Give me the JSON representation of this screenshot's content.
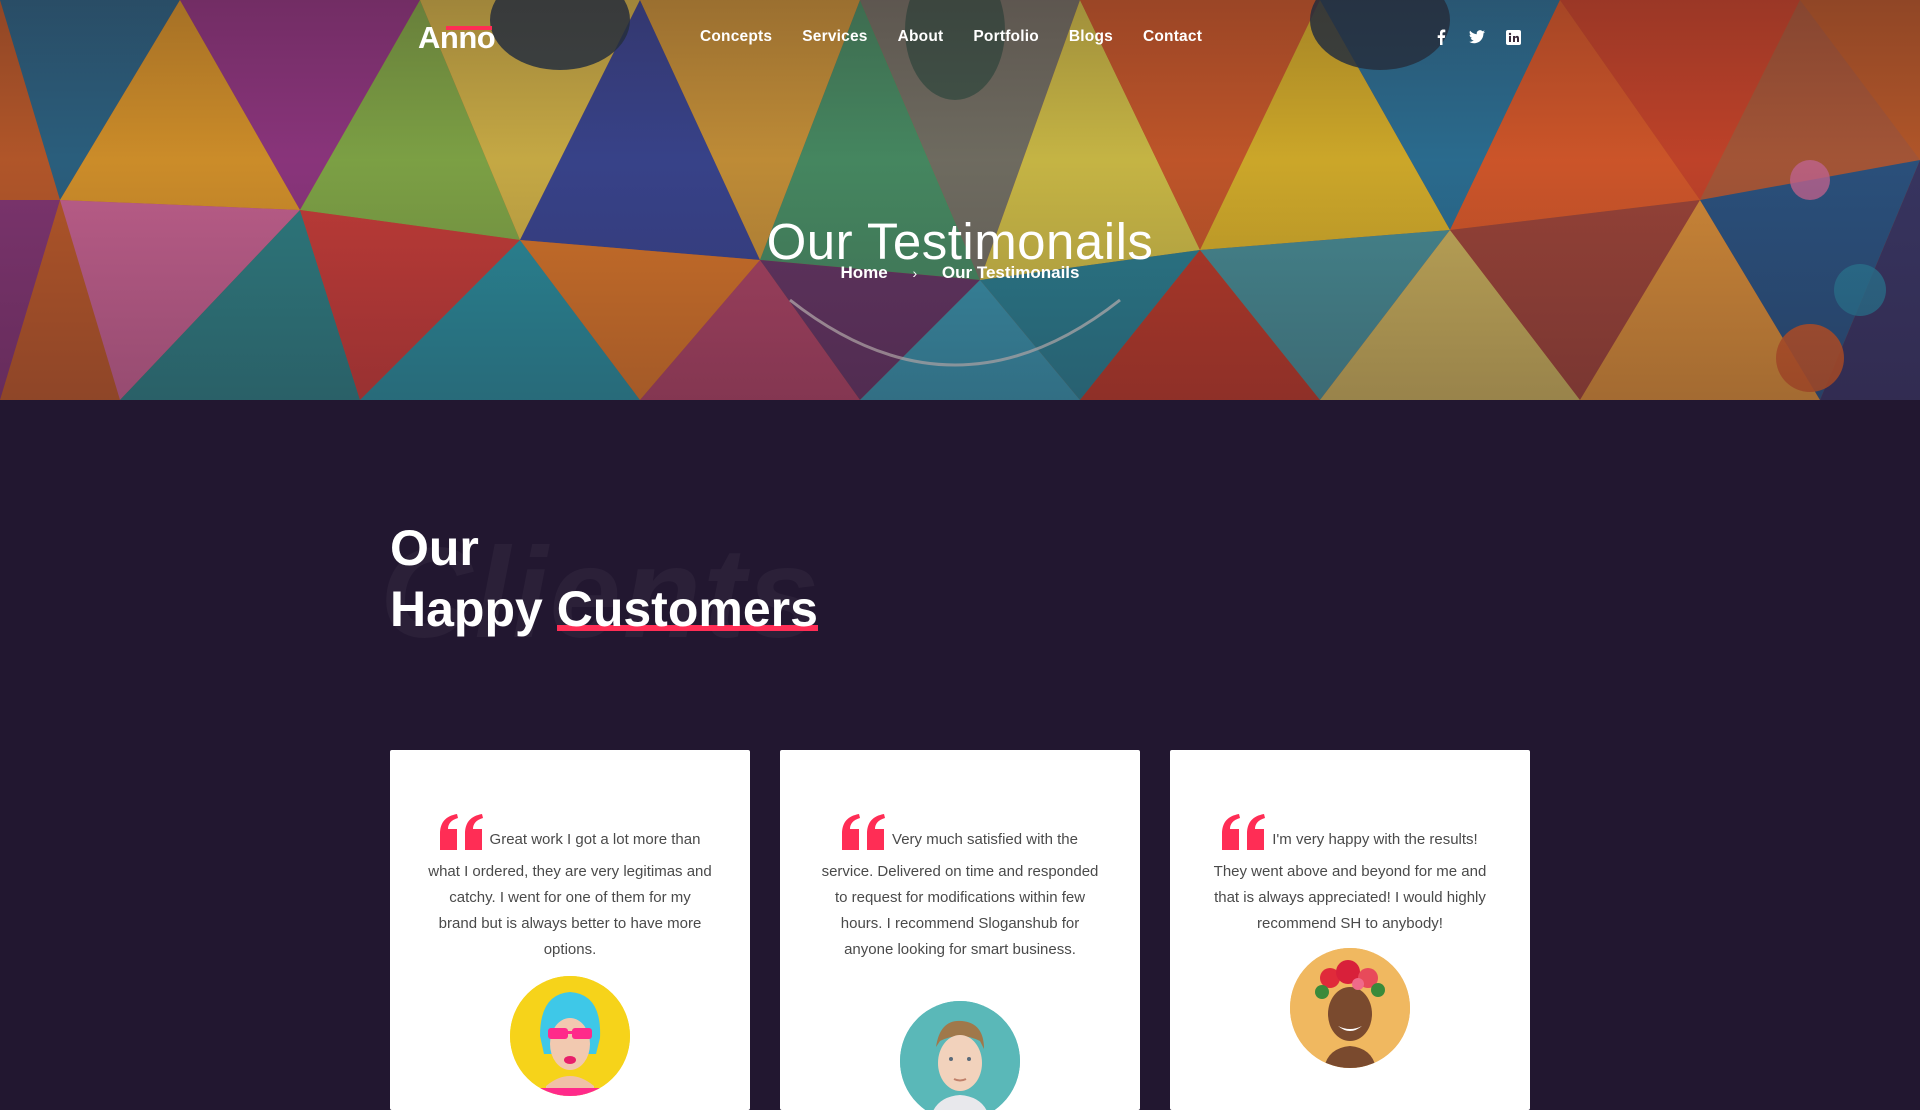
{
  "brand": {
    "logo_text": "Anno",
    "accent_color": "#ff2d55"
  },
  "nav": {
    "items": [
      "Concepts",
      "Services",
      "About",
      "Portfolio",
      "Blogs",
      "Contact"
    ]
  },
  "social": {
    "icons": [
      "facebook-icon",
      "twitter-icon",
      "linkedin-icon"
    ]
  },
  "hero": {
    "title": "Our Testimonails",
    "breadcrumb": {
      "home": "Home",
      "separator": "›",
      "current": "Our Testimonails"
    }
  },
  "section": {
    "heading_line1": "Our",
    "heading_word": "Happy",
    "heading_accent": "Customers",
    "ghost_text": "Clients"
  },
  "testimonials": [
    {
      "text": "Great work I got a lot more than what I ordered, they are very legitimas and catchy. I went for one of them for my brand but is always better to have more options."
    },
    {
      "text": "Very much satisfied with the service. Delivered on time and responded to request for modifications within few hours. I recommend Sloganshub for anyone looking for smart business."
    },
    {
      "text": "I'm very happy with the results! They went above and beyond for me and that is always appreciated! I would highly recommend SH to anybody!"
    }
  ],
  "colors": {
    "background": "#221730",
    "card": "#ffffff",
    "quote_mark": "#ff2d55"
  }
}
